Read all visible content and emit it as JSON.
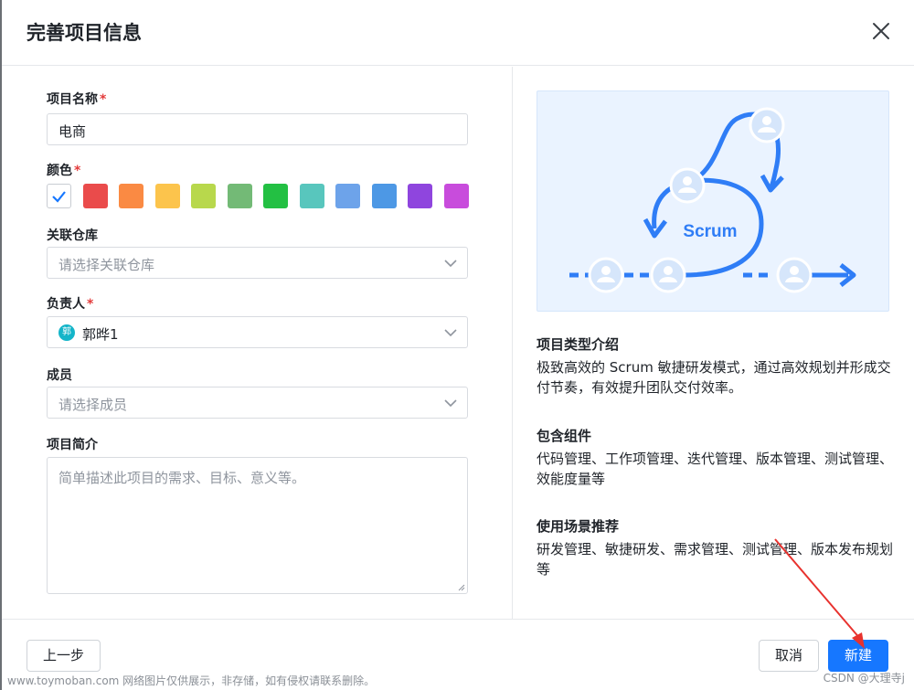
{
  "dialog": {
    "title": "完善项目信息"
  },
  "form": {
    "name_label": "项目名称",
    "name_value": "电商",
    "color_label": "颜色",
    "colors": [
      "#ffffff",
      "#ea4b4b",
      "#fa8a43",
      "#fcc44c",
      "#b8d84c",
      "#73ba76",
      "#23c043",
      "#58c6bd",
      "#6da3ea",
      "#4d98e5",
      "#8f45de",
      "#c84cdc"
    ],
    "selected_color_index": 0,
    "repo_label": "关联仓库",
    "repo_placeholder": "请选择关联仓库",
    "owner_label": "负责人",
    "owner_avatar": "郭",
    "owner_value": "郭晔1",
    "members_label": "成员",
    "members_placeholder": "请选择成员",
    "desc_label": "项目简介",
    "desc_placeholder": "简单描述此项目的需求、目标、意义等。",
    "required_mark": "*"
  },
  "info": {
    "illustration_text": "Scrum",
    "sec1_title": "项目类型介绍",
    "sec1_text": "极致高效的 Scrum 敏捷研发模式，通过高效规划并形成交付节奏，有效提升团队交付效率。",
    "sec2_title": "包含组件",
    "sec2_text": "代码管理、工作项管理、迭代管理、版本管理、测试管理、效能度量等",
    "sec3_title": "使用场景推荐",
    "sec3_text": "研发管理、敏捷研发、需求管理、测试管理、版本发布规划等"
  },
  "footer": {
    "prev_label": "上一步",
    "cancel_label": "取消",
    "create_label": "新建"
  },
  "watermarks": {
    "bottom_left": "www.toymoban.com 网络图片仅供展示，非存储，如有侵权请联系删除。",
    "bottom_right": "CSDN @大理寺j"
  },
  "colors": {
    "primary": "#1677ff",
    "accent_blue": "#2f7df6",
    "required": "#e33b3b"
  }
}
